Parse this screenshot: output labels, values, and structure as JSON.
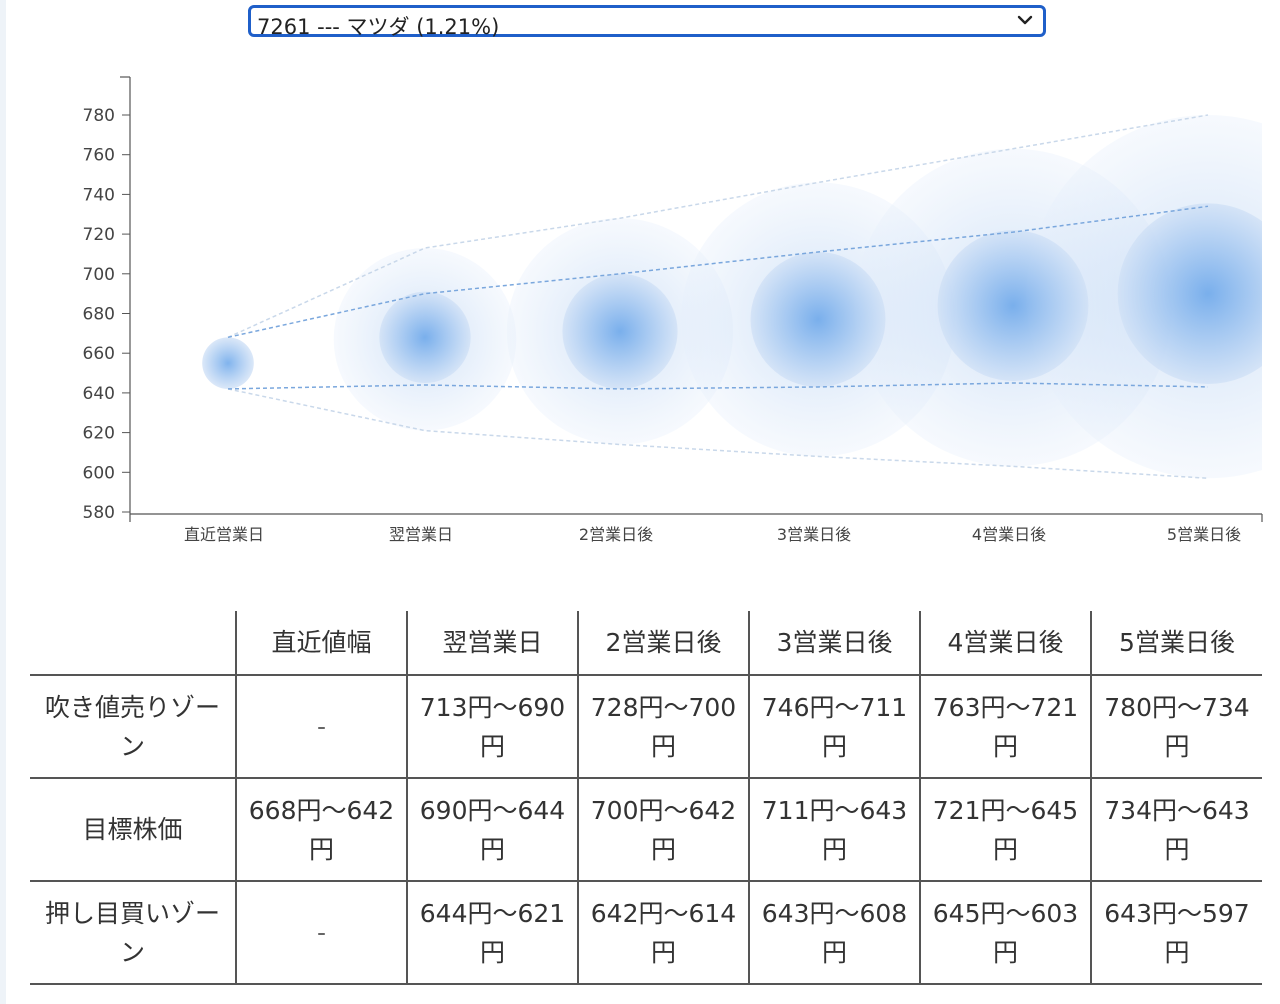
{
  "selector": {
    "value": "7261 --- マツダ (1.21%)"
  },
  "chart_data": {
    "type": "bubble-band",
    "categories": [
      "直近営業日",
      "翌営業日",
      "2営業日後",
      "3営業日後",
      "4営業日後",
      "5営業日後"
    ],
    "y_ticks": [
      580,
      600,
      620,
      640,
      660,
      680,
      700,
      720,
      740,
      760,
      780
    ],
    "ylim": [
      580,
      780
    ],
    "grid": false,
    "series": [
      {
        "values": [
          655,
          668,
          671,
          677,
          684,
          690
        ]
      }
    ],
    "upper_zone": {
      "high": [
        668,
        713,
        728,
        746,
        763,
        780
      ],
      "low": [
        668,
        690,
        700,
        711,
        721,
        734
      ]
    },
    "lower_zone": {
      "high": [
        642,
        644,
        642,
        643,
        645,
        643
      ],
      "low": [
        642,
        621,
        614,
        608,
        603,
        597
      ]
    },
    "colors": {
      "bubble": "#4a90e2",
      "dash": "#7aa7dd",
      "dash_outer": "#c9d8ea",
      "axis": "#555555"
    }
  },
  "table": {
    "headers": [
      "",
      "直近値幅",
      "翌営業日",
      "2営業日後",
      "3営業日後",
      "4営業日後",
      "5営業日後"
    ],
    "rows": [
      {
        "label": "吹き値売りゾーン",
        "cells": [
          "-",
          "713円〜690円",
          "728円〜700円",
          "746円〜711円",
          "763円〜721円",
          "780円〜734円"
        ]
      },
      {
        "label": "目標株価",
        "cells": [
          "668円〜642円",
          "690円〜644円",
          "700円〜642円",
          "711円〜643円",
          "721円〜645円",
          "734円〜643円"
        ]
      },
      {
        "label": "押し目買いゾーン",
        "cells": [
          "-",
          "644円〜621円",
          "642円〜614円",
          "643円〜608円",
          "645円〜603円",
          "643円〜597円"
        ]
      }
    ]
  }
}
